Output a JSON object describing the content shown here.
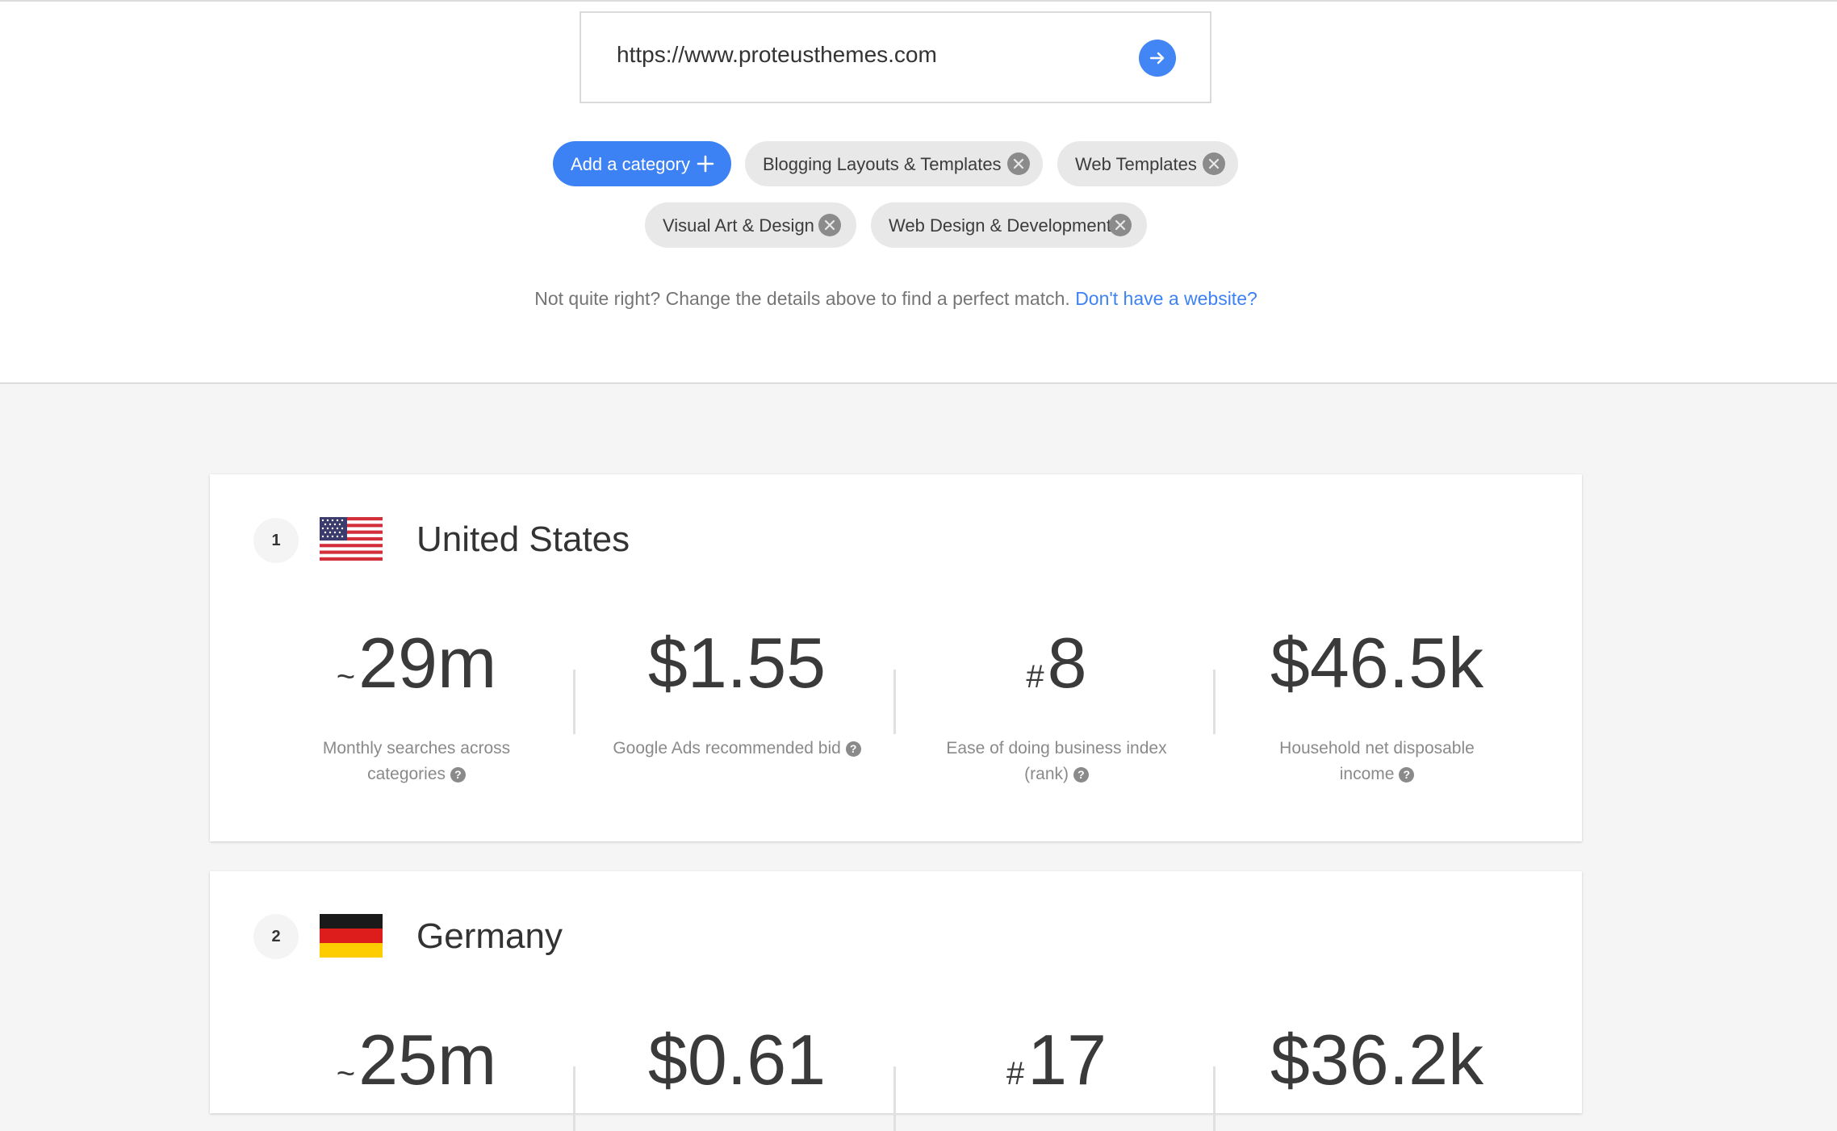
{
  "search": {
    "url": "https://www.proteusthemes.com"
  },
  "categories": {
    "add_label": "Add a category",
    "chips": [
      "Blogging Layouts & Templates",
      "Web Templates",
      "Visual Art & Design",
      "Web Design & Development"
    ]
  },
  "helper": {
    "text": "Not quite right? Change the details above to find a perfect match.",
    "link": "Don't have a website?"
  },
  "metric_labels": {
    "searches_line1": "Monthly searches across",
    "searches_line2": "categories",
    "bid": "Google Ads recommended bid",
    "ease_line1": "Ease of doing business index",
    "ease_line2": "(rank)",
    "income_line1": "Household net disposable",
    "income_line2": "income",
    "help": "?"
  },
  "countries": [
    {
      "rank": "1",
      "name": "United States",
      "searches_prefix": "~",
      "searches": "29m",
      "bid": "$1.55",
      "ease_prefix": "#",
      "ease": "8",
      "income": "$46.5k"
    },
    {
      "rank": "2",
      "name": "Germany",
      "searches_prefix": "~",
      "searches": "25m",
      "bid": "$0.61",
      "ease_prefix": "#",
      "ease": "17",
      "income": "$36.2k"
    }
  ]
}
